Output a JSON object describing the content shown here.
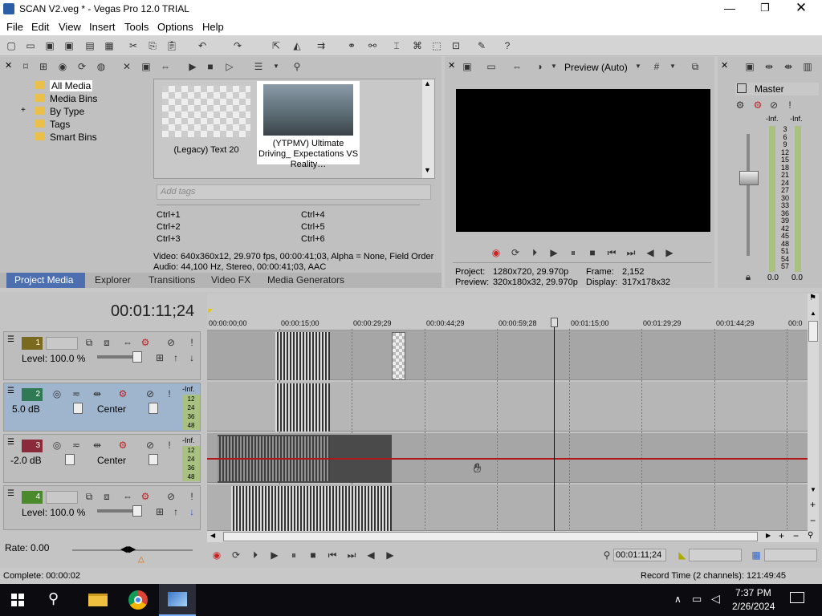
{
  "window": {
    "title": "SCAN V2.veg * - Vegas Pro 12.0 TRIAL"
  },
  "menu": [
    "File",
    "Edit",
    "View",
    "Insert",
    "Tools",
    "Options",
    "Help"
  ],
  "explorer": {
    "tree": [
      "All Media",
      "Media Bins",
      "By Type",
      "Tags",
      "Smart Bins"
    ],
    "expander": "+"
  },
  "media": {
    "items": [
      {
        "label": "(Legacy) Text 20"
      },
      {
        "label": "(YTPMV) Ultimate Driving_ Expectations VS Reality…"
      }
    ],
    "tags_placeholder": "Add tags",
    "shortcuts": [
      "Ctrl+1",
      "Ctrl+2",
      "Ctrl+3",
      "Ctrl+4",
      "Ctrl+5",
      "Ctrl+6"
    ],
    "info_video": "Video: 640x360x12, 29.970 fps, 00:00:41;03, Alpha = None, Field Order",
    "info_audio": "Audio: 44,100 Hz, Stereo, 00:00:41;03, AAC"
  },
  "tabs": [
    "Project Media",
    "Explorer",
    "Transitions",
    "Video FX",
    "Media Generators"
  ],
  "preview": {
    "mode": "Preview (Auto)",
    "project_label": "Project:",
    "project_value": "1280x720, 29.970p",
    "preview_label": "Preview:",
    "preview_value": "320x180x32, 29.970p",
    "frame_label": "Frame:",
    "frame_value": "2,152",
    "display_label": "Display:",
    "display_value": "317x178x32"
  },
  "mixer": {
    "title": "Master",
    "left_inf": "-Inf.",
    "right_inf": "-Inf.",
    "scale": [
      "3",
      "6",
      "9",
      "12",
      "15",
      "18",
      "21",
      "24",
      "27",
      "30",
      "33",
      "36",
      "39",
      "42",
      "45",
      "48",
      "51",
      "54",
      "57"
    ],
    "left_val": "0.0",
    "right_val": "0.0"
  },
  "timeline": {
    "timecode": "00:01:11;24",
    "ruler": [
      "00:00:00;00",
      "00:00:15;00",
      "00:00:29;29",
      "00:00:44;29",
      "00:00:59;28",
      "00:01:15;00",
      "00:01:29;29",
      "00:01:44;29",
      "00:0"
    ],
    "tracks": [
      {
        "num": "1",
        "type": "video",
        "level": "Level: 100.0 %"
      },
      {
        "num": "2",
        "type": "audio",
        "vol": "5.0 dB",
        "pan": "Center",
        "meter_top": "-Inf.",
        "meter": [
          "12",
          "24",
          "36",
          "48"
        ]
      },
      {
        "num": "3",
        "type": "audio",
        "vol": "-2.0 dB",
        "pan": "Center",
        "meter_top": "-Inf.",
        "meter": [
          "12",
          "24",
          "36",
          "48"
        ]
      },
      {
        "num": "4",
        "type": "video",
        "level": "Level: 100.0 %"
      }
    ],
    "rate": "Rate: 0.00",
    "transport_time": "00:01:11;24"
  },
  "status": {
    "left": "Complete: 00:00:02",
    "right": "Record Time (2 channels): 121:49:45"
  },
  "taskbar": {
    "time": "7:37 PM",
    "date": "2/26/2024"
  },
  "colors": {
    "accent": "#0078d7",
    "track_video": "#7a6a20",
    "track_audio2": "#2f7a54",
    "track_audio3": "#8a2a3a",
    "track_video4": "#4b8a2a",
    "cursor": "#333"
  }
}
